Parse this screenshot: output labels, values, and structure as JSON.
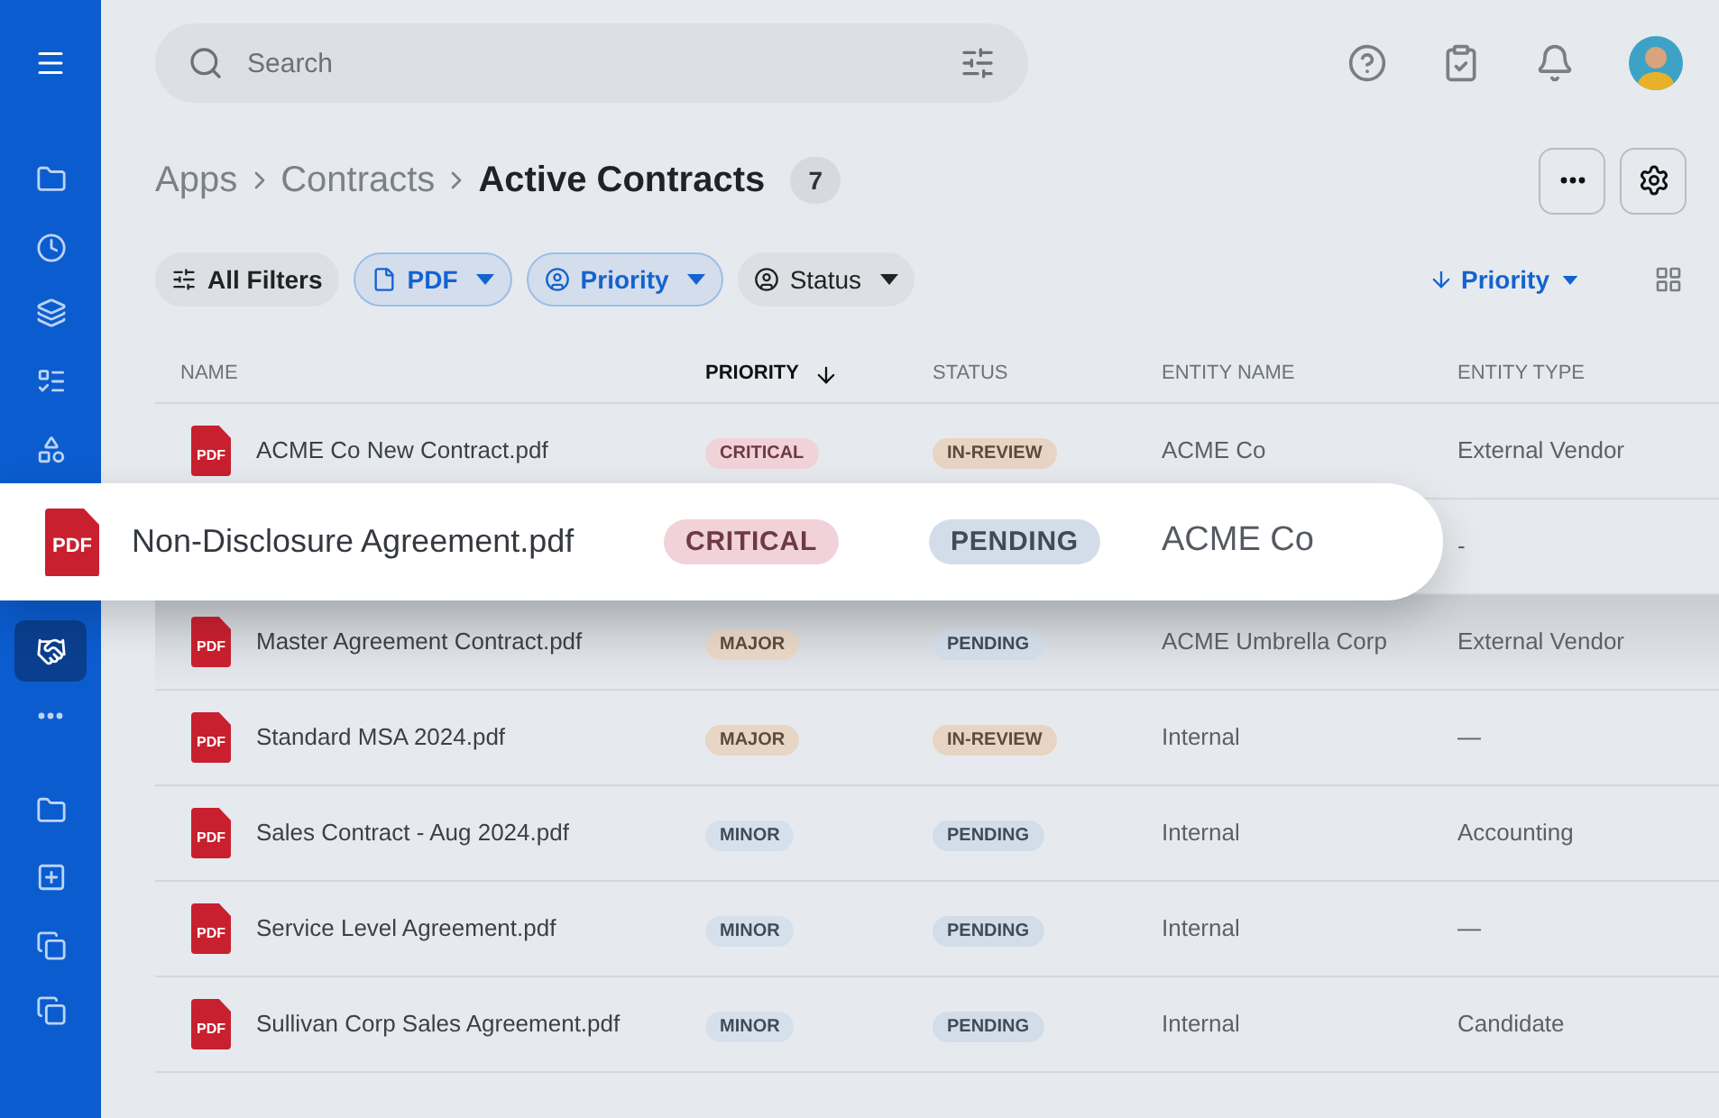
{
  "sidebar": {
    "items": [
      {
        "selected": false
      },
      {
        "selected": false
      },
      {
        "selected": false
      },
      {
        "selected": false
      },
      {
        "selected": false
      },
      {
        "selected": true
      },
      {
        "selected": false
      },
      {
        "selected": false
      },
      {
        "selected": false
      },
      {
        "selected": false
      },
      {
        "selected": false
      }
    ]
  },
  "search": {
    "placeholder": "Search"
  },
  "breadcrumb": {
    "items": [
      "Apps",
      "Contracts"
    ],
    "current": "Active Contracts",
    "count": "7"
  },
  "filters": [
    {
      "label": "All Filters",
      "active": false,
      "dropdown": false
    },
    {
      "label": "PDF",
      "active": true,
      "dropdown": true
    },
    {
      "label": "Priority",
      "active": true,
      "dropdown": true
    },
    {
      "label": "Status",
      "active": false,
      "dropdown": true
    }
  ],
  "sort": {
    "label": "Priority"
  },
  "table": {
    "columns": [
      {
        "label": "NAME",
        "sorted": false
      },
      {
        "label": "PRIORITY",
        "sorted": true
      },
      {
        "label": "STATUS",
        "sorted": false
      },
      {
        "label": "ENTITY NAME",
        "sorted": false
      },
      {
        "label": "ENTITY TYPE",
        "sorted": false
      }
    ],
    "rows": [
      {
        "file_type": "PDF",
        "name": "ACME Co New Contract.pdf",
        "priority": {
          "text": "CRITICAL",
          "kind": "critical"
        },
        "status": {
          "text": "IN-REVIEW",
          "kind": "review"
        },
        "entity_name": "ACME Co",
        "entity_type": "External Vendor",
        "highlighted": false
      },
      {
        "file_type": "PDF",
        "name": "Non-Disclosure Agreement.pdf",
        "priority": {
          "text": "CRITICAL",
          "kind": "critical"
        },
        "status": {
          "text": "PENDING",
          "kind": "pending"
        },
        "entity_name": "ACME Co",
        "entity_type": "-",
        "highlighted": true
      },
      {
        "file_type": "PDF",
        "name": "Master Agreement Contract.pdf",
        "priority": {
          "text": "MAJOR",
          "kind": "major"
        },
        "status": {
          "text": "PENDING",
          "kind": "pending"
        },
        "entity_name": "ACME Umbrella Corp",
        "entity_type": "External Vendor",
        "highlighted": false
      },
      {
        "file_type": "PDF",
        "name": "Standard MSA 2024.pdf",
        "priority": {
          "text": "MAJOR",
          "kind": "major"
        },
        "status": {
          "text": "IN-REVIEW",
          "kind": "review"
        },
        "entity_name": "Internal",
        "entity_type": "—",
        "highlighted": false
      },
      {
        "file_type": "PDF",
        "name": "Sales Contract - Aug 2024.pdf",
        "priority": {
          "text": "MINOR",
          "kind": "minor"
        },
        "status": {
          "text": "PENDING",
          "kind": "pending"
        },
        "entity_name": "Internal",
        "entity_type": "Accounting",
        "highlighted": false
      },
      {
        "file_type": "PDF",
        "name": "Service Level Agreement.pdf",
        "priority": {
          "text": "MINOR",
          "kind": "minor"
        },
        "status": {
          "text": "PENDING",
          "kind": "pending"
        },
        "entity_name": "Internal",
        "entity_type": "—",
        "highlighted": false
      },
      {
        "file_type": "PDF",
        "name": "Sullivan Corp Sales Agreement.pdf",
        "priority": {
          "text": "MINOR",
          "kind": "minor"
        },
        "status": {
          "text": "PENDING",
          "kind": "pending"
        },
        "entity_name": "Internal",
        "entity_type": "Candidate",
        "highlighted": false
      }
    ]
  }
}
